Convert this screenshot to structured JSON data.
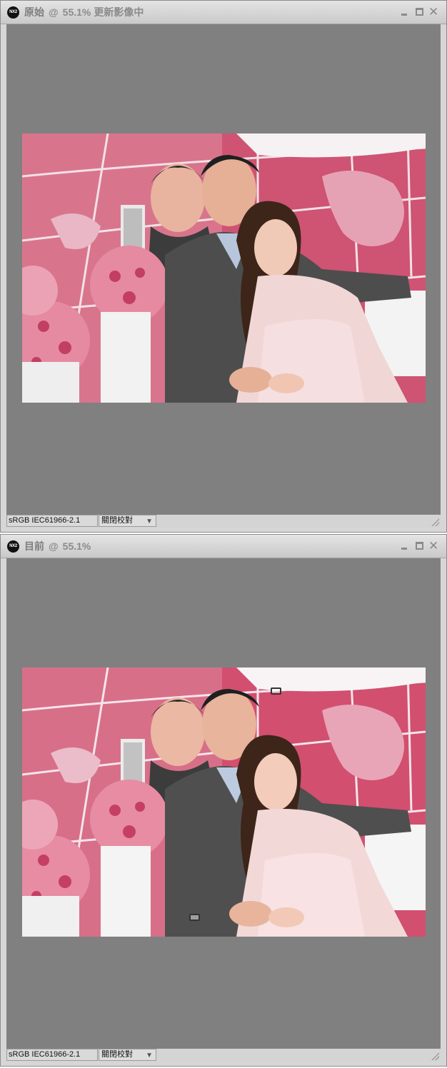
{
  "windows": [
    {
      "title_name": "原始",
      "at": "@",
      "zoom": "55.1%",
      "status": "更新影像中",
      "profile": "sRGB IEC61966-2.1",
      "proof_option": "關閉校對",
      "app_icon_text": "NX2",
      "image_description": "wedding couple photo, original",
      "markers": false
    },
    {
      "title_name": "目前",
      "at": "@",
      "zoom": "55.1%",
      "status": "",
      "profile": "sRGB IEC61966-2.1",
      "proof_option": "關閉校對",
      "app_icon_text": "NX2",
      "image_description": "wedding couple photo, current",
      "markers": true
    }
  ],
  "colors": {
    "canvas_bg": "#808080",
    "titlebar_text": "#8a8a8a",
    "backdrop_pink": "#d2506f",
    "map_white": "#f3dde3",
    "suit_gray": "#4d4d4d",
    "dress_pink": "#f4d7d8",
    "rose_pink": "#e28aa0"
  },
  "icons": {
    "minimize": "minimize-icon",
    "maximize": "maximize-icon",
    "close": "close-icon",
    "dropdown": "chevron-down-icon",
    "resize": "resize-grip-icon"
  }
}
